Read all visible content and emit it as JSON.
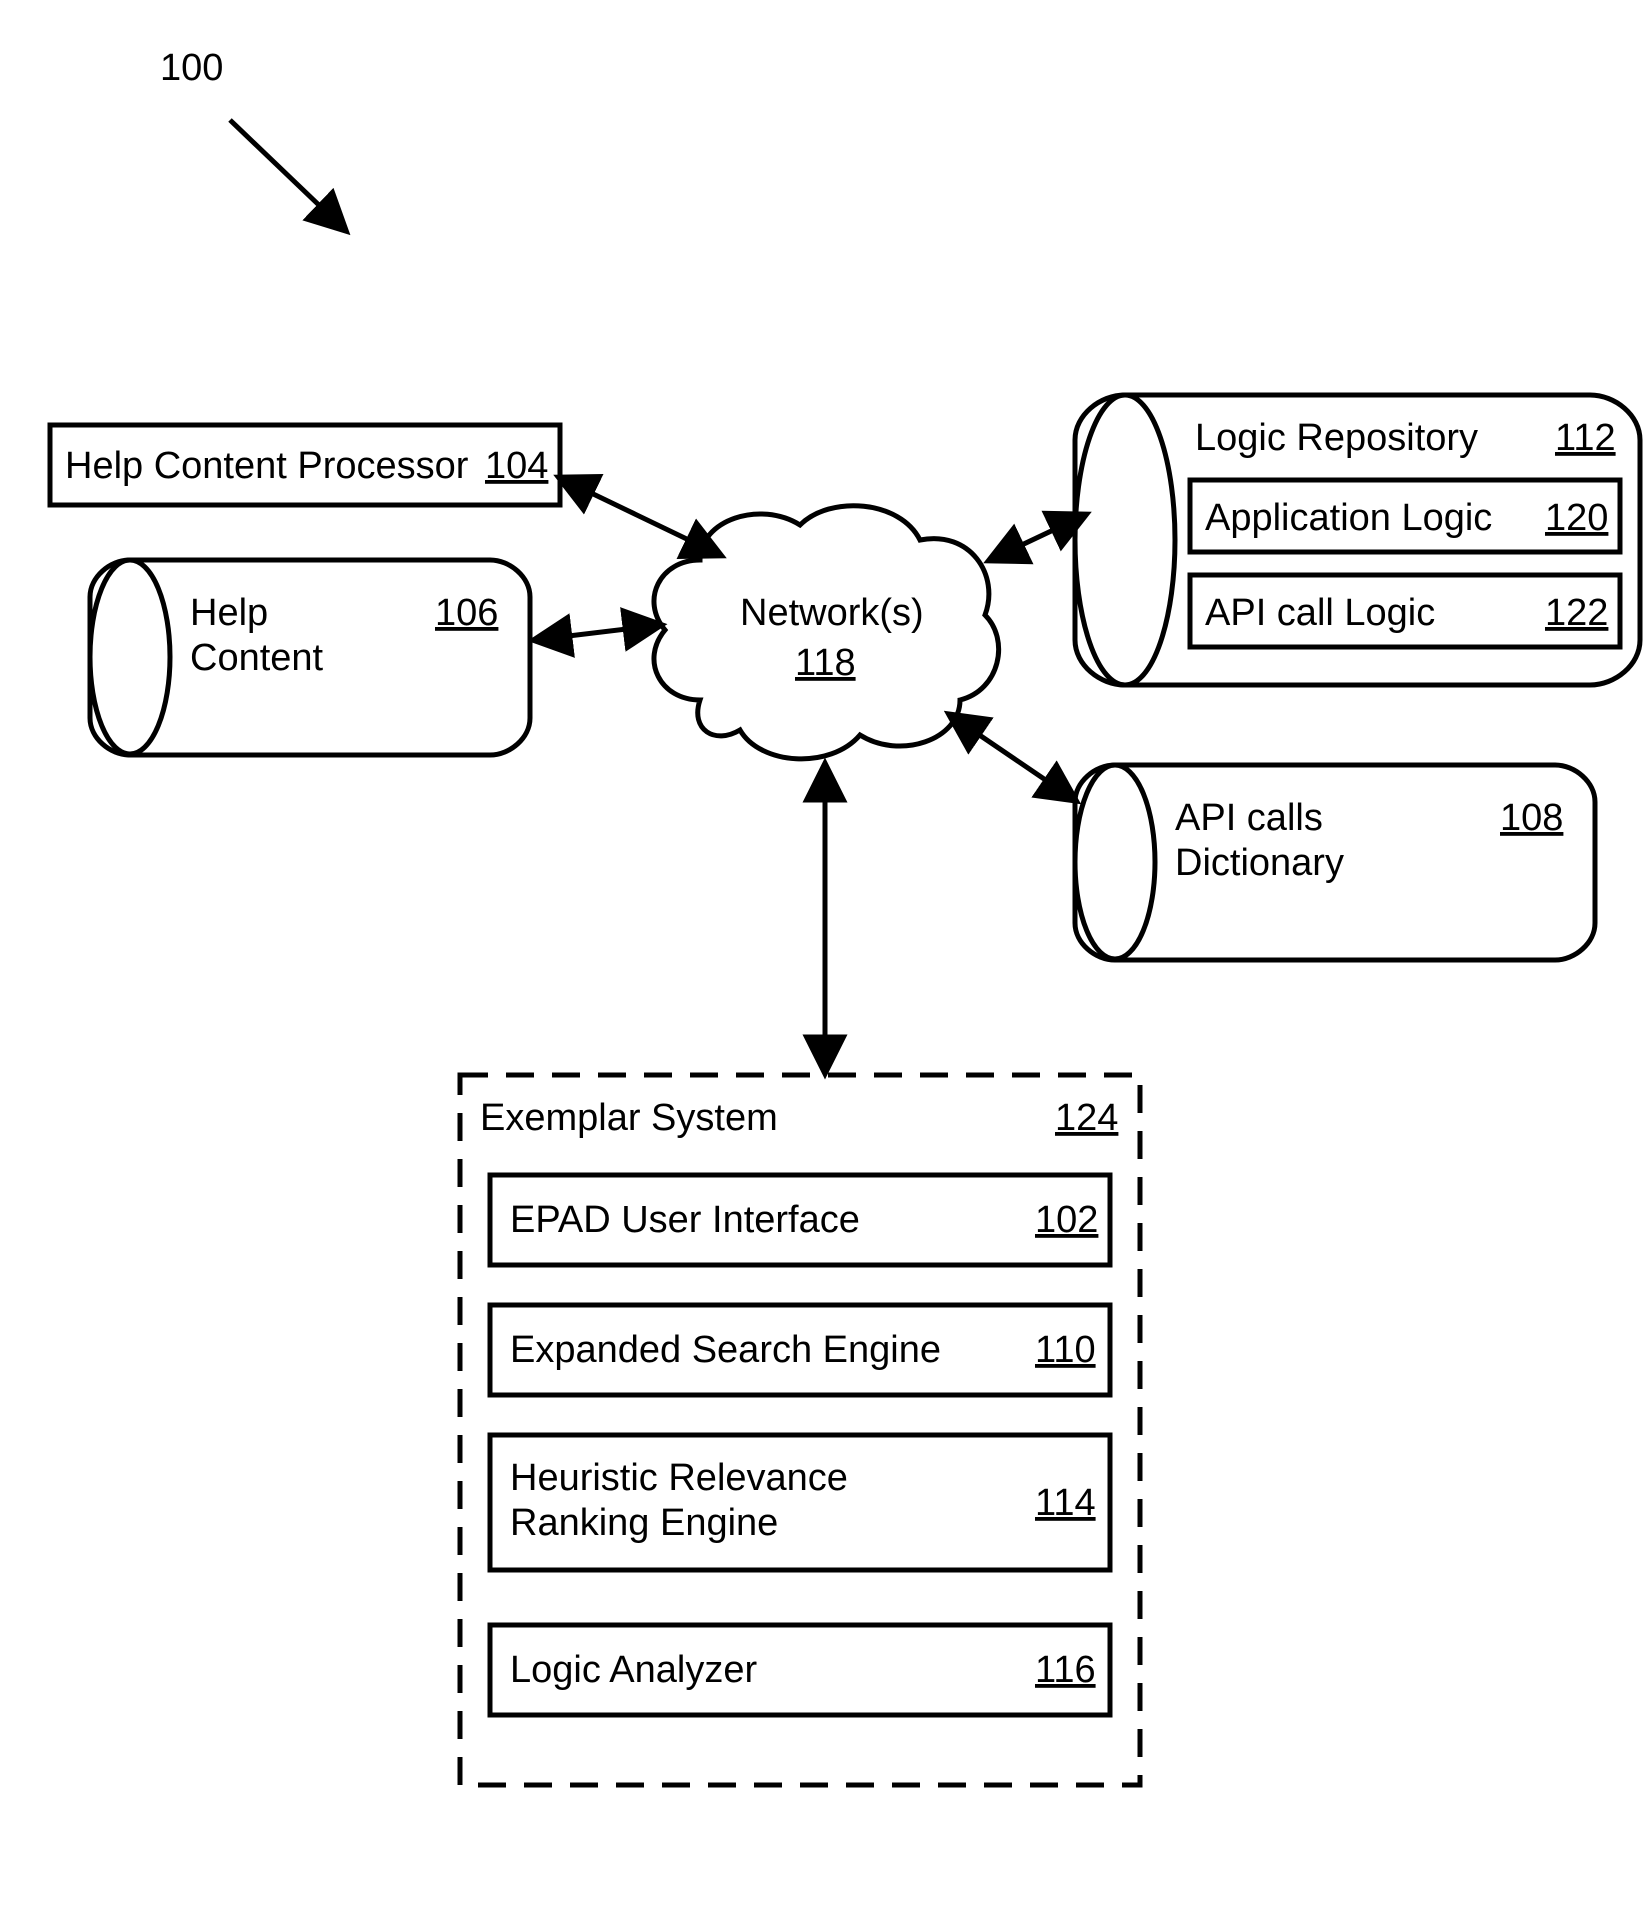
{
  "figure": {
    "ref": "100",
    "network": {
      "label": "Network(s)",
      "ref": "118"
    },
    "help_processor": {
      "label": "Help Content Processor",
      "ref": "104"
    },
    "help_content": {
      "line1": "Help",
      "line2": "Content",
      "ref": "106"
    },
    "logic_repo": {
      "label": "Logic Repository",
      "ref": "112"
    },
    "app_logic": {
      "label": "Application Logic",
      "ref": "120"
    },
    "api_logic": {
      "label": "API call Logic",
      "ref": "122"
    },
    "api_dict": {
      "line1": "API calls",
      "line2": "Dictionary",
      "ref": "108"
    },
    "exemplar": {
      "label": "Exemplar System",
      "ref": "124"
    },
    "epad": {
      "label": "EPAD User Interface",
      "ref": "102"
    },
    "search": {
      "label": "Expanded Search Engine",
      "ref": "110"
    },
    "ranking": {
      "line1": "Heuristic Relevance",
      "line2": "Ranking Engine",
      "ref": "114"
    },
    "analyzer": {
      "label": "Logic Analyzer",
      "ref": "116"
    }
  }
}
